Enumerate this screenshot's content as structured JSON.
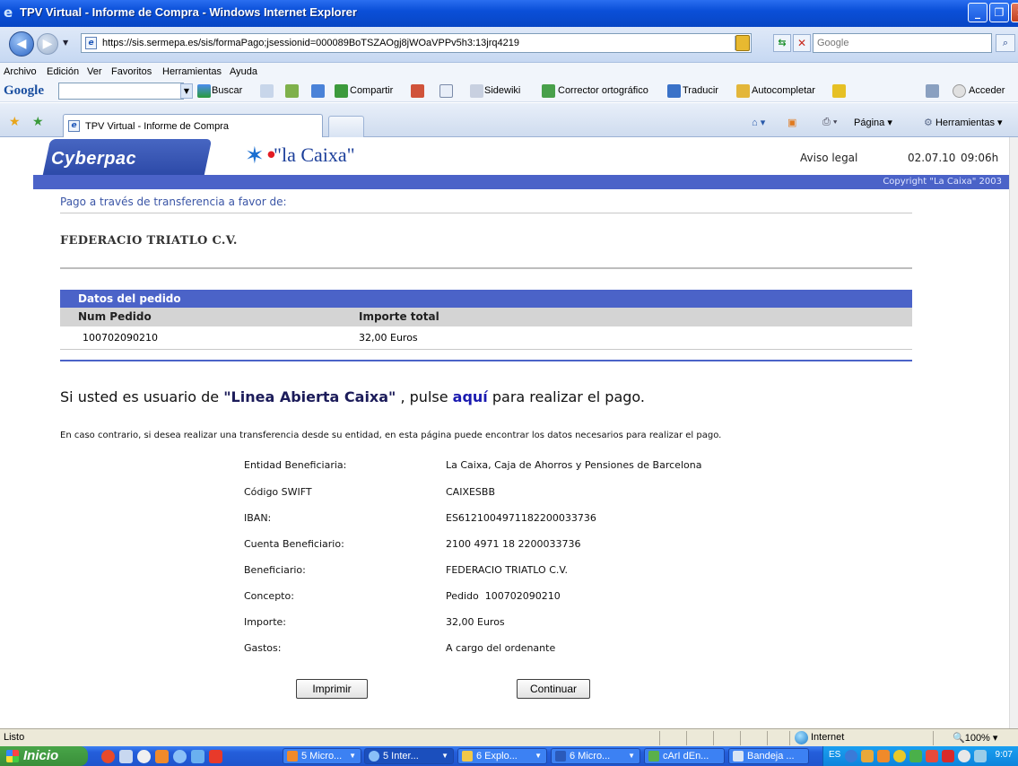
{
  "window": {
    "title": "TPV Virtual - Informe de Compra - Windows Internet Explorer"
  },
  "browser": {
    "url": "https://sis.sermepa.es/sis/formaPago;jsessionid=000089BoTSZAOgj8jWOaVPPv5h3:13jrq4219",
    "search_placeholder": "Google",
    "menu": [
      "Archivo",
      "Edición",
      "Ver",
      "Favoritos",
      "Herramientas",
      "Ayuda"
    ],
    "google_toolbar": {
      "logo": "Google",
      "buscar": "Buscar",
      "compartir": "Compartir",
      "sidewiki": "Sidewiki",
      "corrector": "Corrector ortográfico",
      "traducir": "Traducir",
      "autocompletar": "Autocompletar",
      "acceder": "Acceder"
    },
    "tab_label": "TPV Virtual - Informe de Compra",
    "commands": {
      "pagina": "Página",
      "herramientas": "Herramientas"
    },
    "status": {
      "left": "Listo",
      "zone": "Internet",
      "zoom": "100%"
    }
  },
  "header": {
    "cyberpac_logo": "Cyberpac",
    "caixa_logo": "\"la Caixa\"",
    "aviso_legal": "Aviso legal",
    "date": "02.07.10",
    "time": "09:06h",
    "copyright": "Copyright \"La Caixa\" 2003"
  },
  "payment": {
    "title": "Pago a través de transferencia a favor de:",
    "beneficiary_name": "FEDERACIO TRIATLO C.V."
  },
  "order": {
    "section_title": "Datos del pedido",
    "columns": [
      "Num Pedido",
      "Importe total"
    ],
    "rows": [
      [
        "100702090210",
        "32,00 Euros"
      ]
    ]
  },
  "linea": {
    "prefix": "Si usted es usuario de ",
    "product": "\"Linea Abierta Caixa\"",
    "middle": " , pulse ",
    "link": "aquí",
    "suffix": " para realizar el pago."
  },
  "contrario_text": "En caso contrario, si desea realizar una transferencia desde su entidad, en esta página puede encontrar los datos necesarios para realizar el pago.",
  "details": [
    {
      "label": "Entidad Beneficiaria:",
      "value": "La Caixa, Caja de Ahorros y Pensiones de Barcelona"
    },
    {
      "label": "Código SWIFT",
      "value": "CAIXESBB"
    },
    {
      "label": "IBAN:",
      "value": "ES6121004971182200033736"
    },
    {
      "label": "Cuenta Beneficiario:",
      "value": "2100 4971 18 2200033736"
    },
    {
      "label": "Beneficiario:",
      "value": "FEDERACIO TRIATLO C.V."
    },
    {
      "label": "Concepto:",
      "value": "Pedido  100702090210"
    },
    {
      "label": "Importe:",
      "value": "32,00 Euros"
    },
    {
      "label": "Gastos:",
      "value": "A cargo del ordenante"
    }
  ],
  "buttons": {
    "imprimir": "Imprimir",
    "continuar": "Continuar"
  },
  "taskbar": {
    "start": "Inicio",
    "tasks": [
      "5 Micro...",
      "5 Inter...",
      "6 Explo...",
      "6 Micro...",
      "cArI dEn...",
      "Bandeja ..."
    ],
    "lang": "ES",
    "clock": "9:07"
  }
}
